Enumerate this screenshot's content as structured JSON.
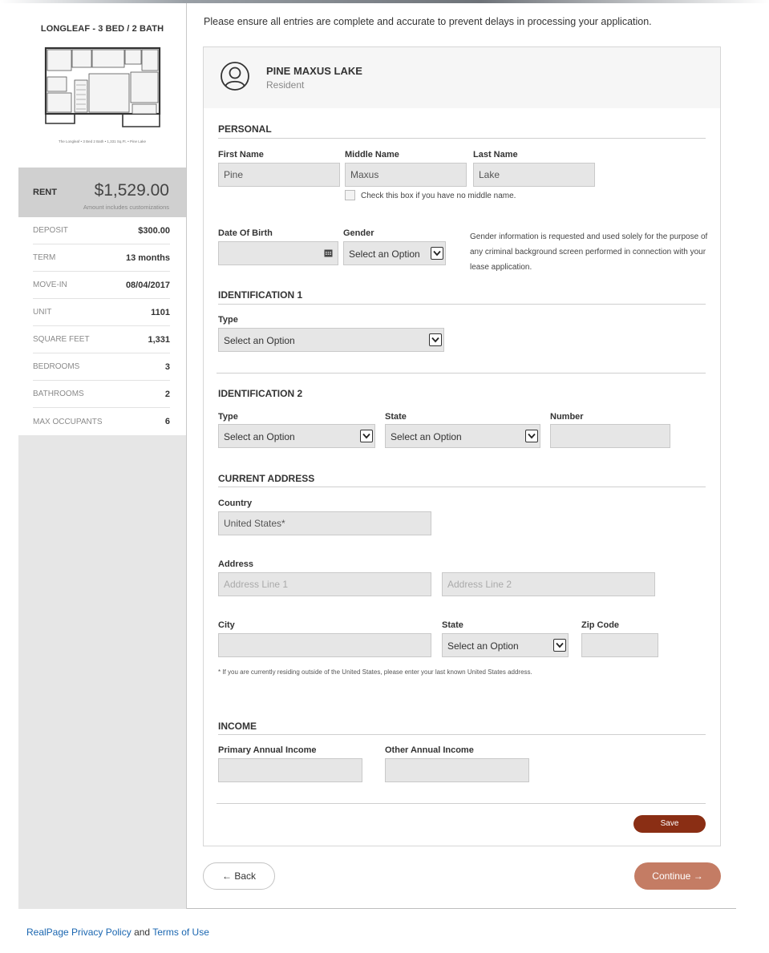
{
  "notice": "Please ensure all entries are complete and accurate to prevent delays in processing your application.",
  "sidebar": {
    "plan_name": "LONGLEAF - 3 BED / 2 BATH",
    "plan_caption": "The Longleaf • 3 Bed 2 Bath • 1,331 Sq.Ft. • Pine Lake",
    "rent_label": "RENT",
    "rent_value": "$1,529.00",
    "rent_note": "Amount includes customizations",
    "details": [
      {
        "label": "DEPOSIT",
        "value": "$300.00"
      },
      {
        "label": "TERM",
        "value": "13 months"
      },
      {
        "label": "MOVE-IN",
        "value": "08/04/2017"
      },
      {
        "label": "UNIT",
        "value": "1101"
      },
      {
        "label": "SQUARE FEET",
        "value": "1,331"
      },
      {
        "label": "BEDROOMS",
        "value": "3"
      },
      {
        "label": "BATHROOMS",
        "value": "2"
      },
      {
        "label": "MAX OCCUPANTS",
        "value": "6"
      }
    ]
  },
  "resident": {
    "name": "PINE MAXUS LAKE",
    "role": "Resident"
  },
  "personal": {
    "title": "PERSONAL",
    "first_name_label": "First Name",
    "first_name": "Pine",
    "middle_name_label": "Middle Name",
    "middle_name": "Maxus",
    "last_name_label": "Last Name",
    "last_name": "Lake",
    "no_middle_label": "Check this box if you have no middle name.",
    "dob_label": "Date Of Birth",
    "dob": "",
    "gender_label": "Gender",
    "gender": "Select an Option",
    "gender_note": "Gender information is requested and used solely for the purpose of any criminal background screen performed in connection with your lease application."
  },
  "id1": {
    "title": "IDENTIFICATION 1",
    "type_label": "Type",
    "type": "Select an Option"
  },
  "id2": {
    "title": "IDENTIFICATION 2",
    "type_label": "Type",
    "type": "Select an Option",
    "state_label": "State",
    "state": "Select an Option",
    "number_label": "Number",
    "number": ""
  },
  "address": {
    "title": "CURRENT ADDRESS",
    "country_label": "Country",
    "country": "United States*",
    "address_label": "Address",
    "line1_placeholder": "Address Line 1",
    "line2_placeholder": "Address Line 2",
    "city_label": "City",
    "city": "",
    "state_label": "State",
    "state": "Select an Option",
    "zip_label": "Zip Code",
    "zip": "",
    "footnote": "* If you are currently residing outside of the United States, please enter your last known United States address."
  },
  "income": {
    "title": "INCOME",
    "primary_label": "Primary Annual Income",
    "primary": "",
    "other_label": "Other Annual Income",
    "other": ""
  },
  "buttons": {
    "save": "Save",
    "back": "Back",
    "continue": "Continue"
  },
  "footer": {
    "privacy_link": "RealPage Privacy Policy",
    "and": " and ",
    "terms_link": "Terms of Use"
  },
  "colors": {
    "save_button": "#8a2e14",
    "continue_button": "#c47c64",
    "link": "#1a66b0"
  }
}
